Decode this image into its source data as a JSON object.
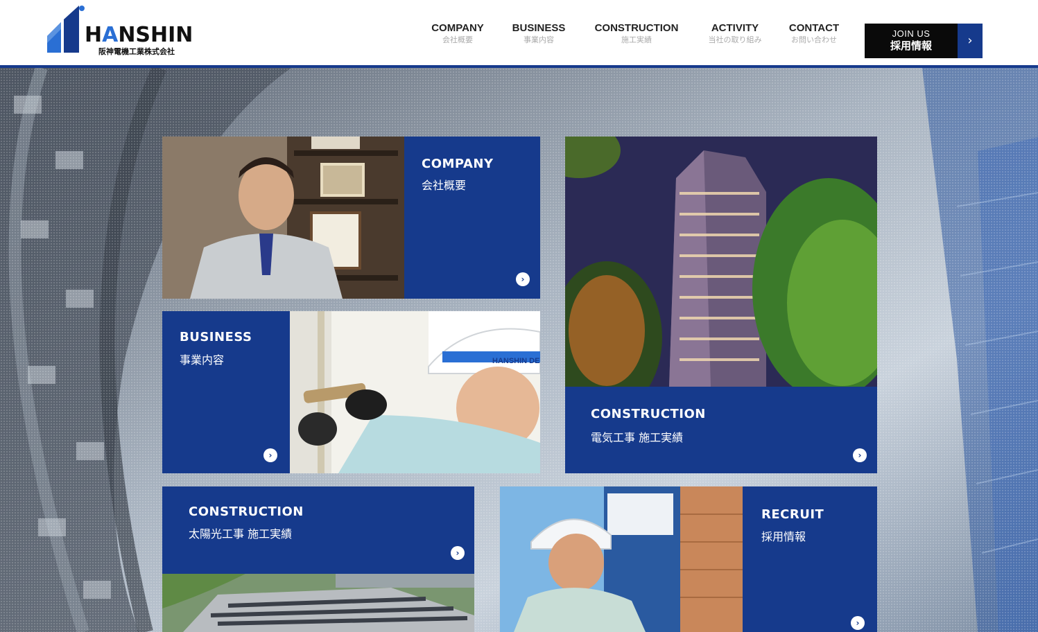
{
  "colors": {
    "brand_blue": "#163a8c",
    "header_bg": "#ffffff",
    "join_bg": "#0a0a0a",
    "logo_accent": "#2a6fd4"
  },
  "logo": {
    "prefix": "H",
    "accent": "A",
    "rest": "NSHIN",
    "subtitle": "阪神電機工業株式会社"
  },
  "nav": [
    {
      "en": "COMPANY",
      "jp": "会社概要"
    },
    {
      "en": "BUSINESS",
      "jp": "事業内容"
    },
    {
      "en": "CONSTRUCTION",
      "jp": "施工実績"
    },
    {
      "en": "ACTIVITY",
      "jp": "当社の取り組み"
    },
    {
      "en": "CONTACT",
      "jp": "お問い合わせ"
    }
  ],
  "join": {
    "en": "JOIN US",
    "jp": "採用情報",
    "icon": "chevron-right-icon"
  },
  "cards": [
    {
      "title": "COMPANY",
      "sub": "会社概要",
      "photo": "company-staff-photo"
    },
    {
      "title": "BUSINESS",
      "sub": "事業内容",
      "photo": "business-worker-photo"
    },
    {
      "title": "CONSTRUCTION",
      "sub": "電気工事 施工実績",
      "photo": "tower-night-photo"
    },
    {
      "title": "CONSTRUCTION",
      "sub": "太陽光工事 施工実績",
      "photo": "solar-roof-photo"
    },
    {
      "title": "RECRUIT",
      "sub": "採用情報",
      "photo": "recruit-worker-photo"
    }
  ],
  "photo_labels": {
    "helmet_text": "HANSHIN DE"
  }
}
